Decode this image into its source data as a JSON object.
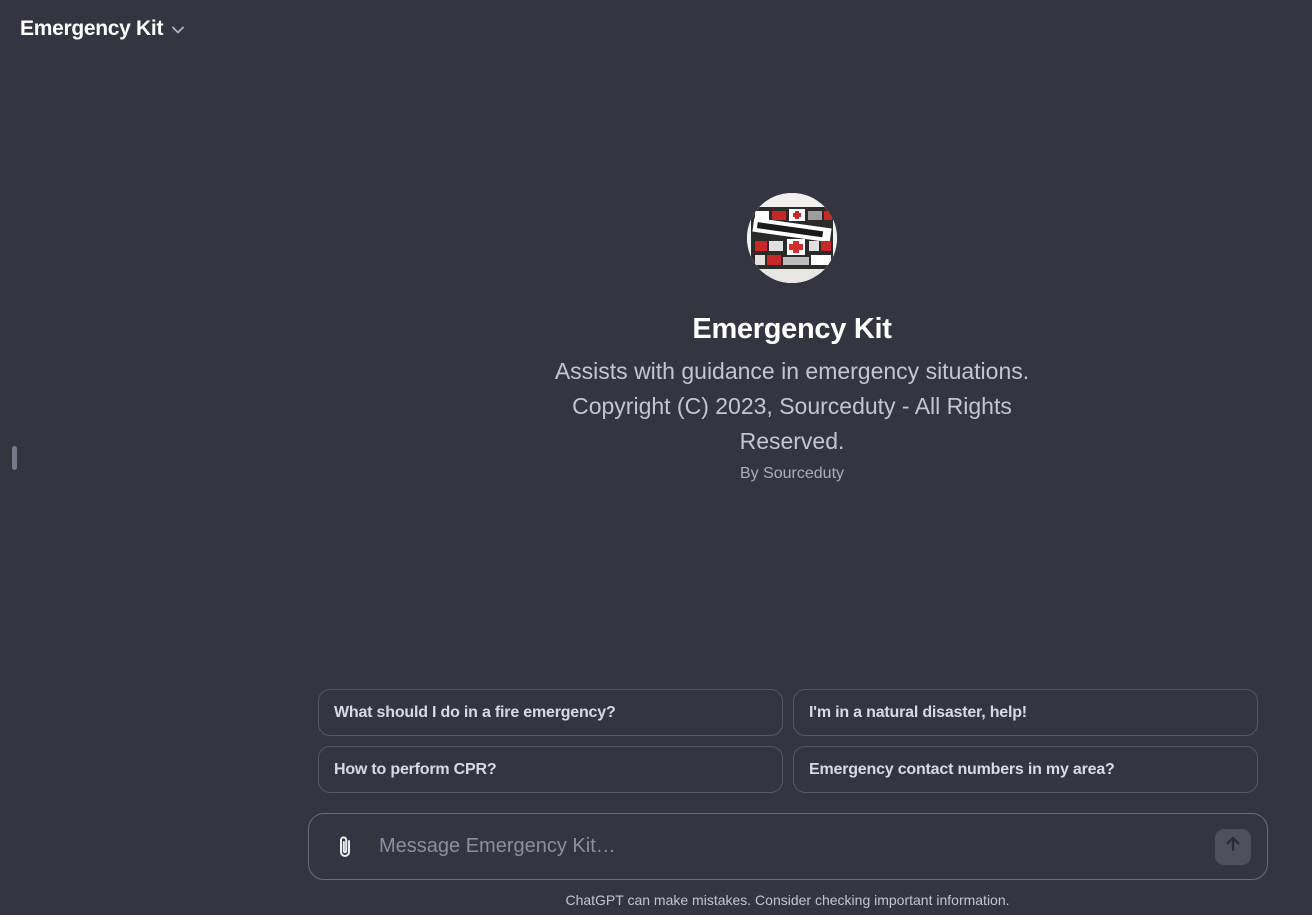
{
  "header": {
    "title": "Emergency Kit",
    "dropdown_icon": "chevron-down-icon"
  },
  "hero": {
    "avatar_icon": "emergency-kit-logo",
    "name": "Emergency Kit",
    "description": "Assists with guidance in emergency situations. Copyright (C) 2023, Sourceduty - All Rights Reserved.",
    "author": "By Sourceduty"
  },
  "suggestions": [
    {
      "label": "What should I do in a fire emergency?"
    },
    {
      "label": "I'm in a natural disaster, help!"
    },
    {
      "label": "How to perform CPR?"
    },
    {
      "label": "Emergency contact numbers in my area?"
    }
  ],
  "composer": {
    "placeholder": "Message Emergency Kit…",
    "value": "",
    "attach_icon": "paperclip-icon",
    "send_icon": "arrow-up-icon"
  },
  "footer": {
    "disclaimer": "ChatGPT can make mistakes. Consider checking important information."
  },
  "colors": {
    "background": "#343541",
    "text_primary": "#ffffff",
    "text_secondary": "#c5c5d2",
    "border": "#565869",
    "accent_red": "#d32f2f"
  }
}
